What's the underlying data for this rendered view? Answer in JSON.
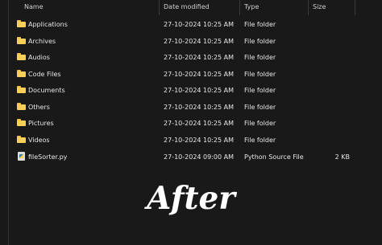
{
  "header": {
    "name_label": "Name",
    "date_label": "Date modified",
    "type_label": "Type",
    "size_label": "Size",
    "sort_icon": "chevron-up-icon"
  },
  "files": [
    {
      "name": "Applications",
      "date": "27-10-2024 10:25 AM",
      "type": "File folder",
      "size": "",
      "icon": "folder-icon"
    },
    {
      "name": "Archives",
      "date": "27-10-2024 10:25 AM",
      "type": "File folder",
      "size": "",
      "icon": "folder-icon"
    },
    {
      "name": "Audios",
      "date": "27-10-2024 10:25 AM",
      "type": "File folder",
      "size": "",
      "icon": "folder-icon"
    },
    {
      "name": "Code Files",
      "date": "27-10-2024 10:25 AM",
      "type": "File folder",
      "size": "",
      "icon": "folder-icon"
    },
    {
      "name": "Documents",
      "date": "27-10-2024 10:25 AM",
      "type": "File folder",
      "size": "",
      "icon": "folder-icon"
    },
    {
      "name": "Others",
      "date": "27-10-2024 10:25 AM",
      "type": "File folder",
      "size": "",
      "icon": "folder-icon"
    },
    {
      "name": "Pictures",
      "date": "27-10-2024 10:25 AM",
      "type": "File folder",
      "size": "",
      "icon": "folder-icon"
    },
    {
      "name": "Videos",
      "date": "27-10-2024 10:25 AM",
      "type": "File folder",
      "size": "",
      "icon": "folder-icon"
    },
    {
      "name": "fileSorter.py",
      "date": "27-10-2024 09:00 AM",
      "type": "Python Source File",
      "size": "2 KB",
      "icon": "python-file-icon"
    }
  ],
  "overlay_text": "After",
  "colors": {
    "background": "#191919",
    "text": "#e6e6e6",
    "folder": "#f8d057"
  }
}
